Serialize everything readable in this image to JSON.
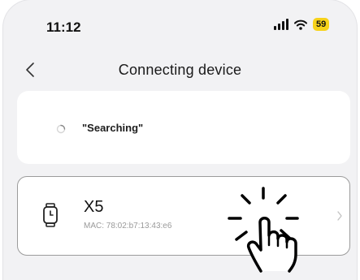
{
  "status_bar": {
    "time": "11:12",
    "battery": "59",
    "signal_icon": "signal-icon",
    "wifi_icon": "wifi-icon"
  },
  "header": {
    "back_icon": "chevron-left-icon",
    "title": "Connecting device"
  },
  "search_card": {
    "spinner_icon": "spinner-icon",
    "status_text": "\"Searching\""
  },
  "device_card": {
    "icon": "watch-icon",
    "name": "X5",
    "mac": "MAC: 78:02:b7:13:43:e6",
    "chevron_icon": "chevron-right-icon"
  },
  "overlay": {
    "icon": "tap-hand-icon"
  },
  "colors": {
    "screen_background": "#f2f2f4",
    "card_background": "#ffffff",
    "battery_badge": "#f7d21a",
    "mac_text": "#9a9a9a"
  }
}
